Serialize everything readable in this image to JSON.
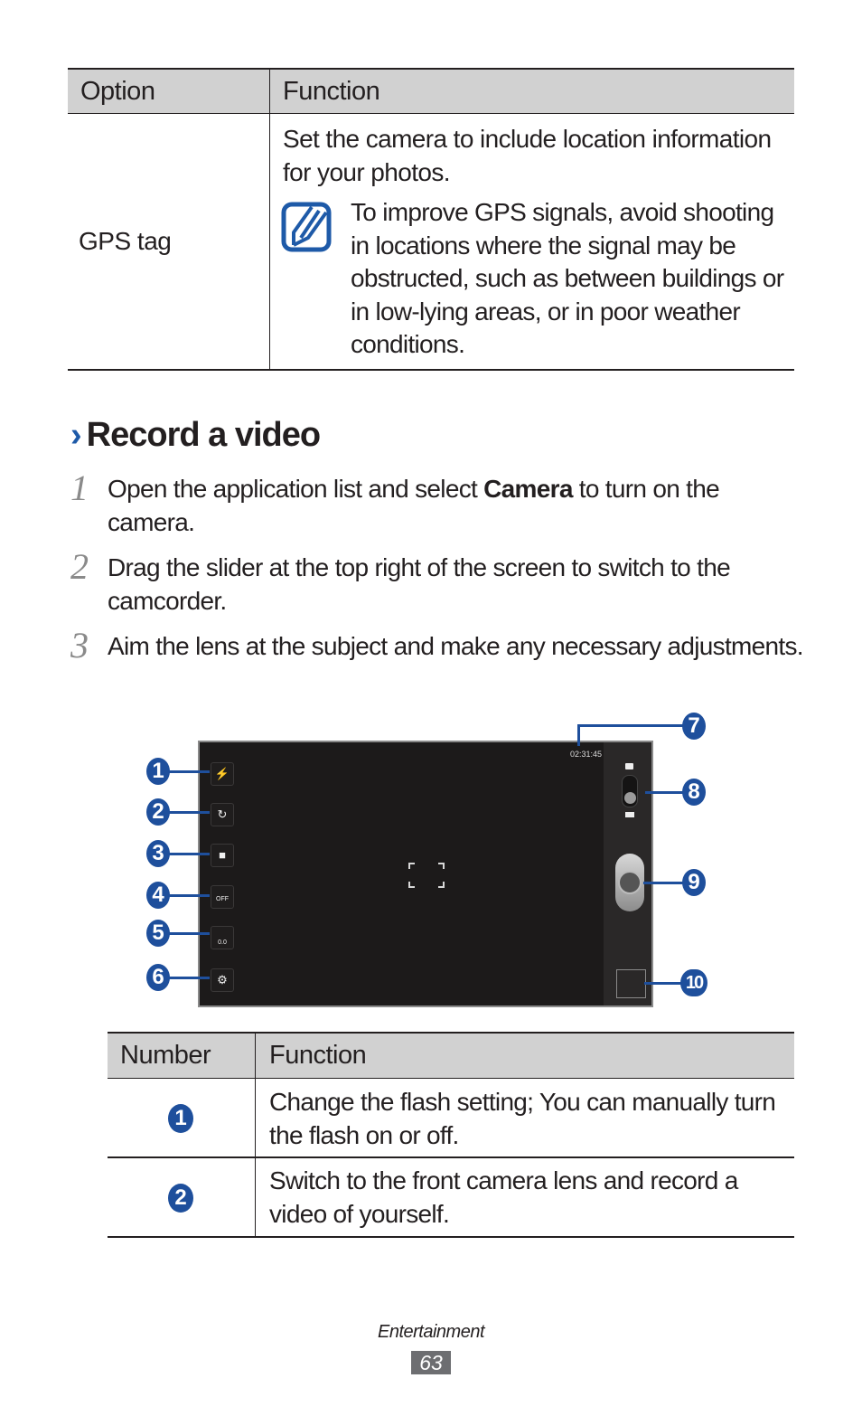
{
  "options_table": {
    "headers": [
      "Option",
      "Function"
    ],
    "rows": [
      {
        "option": "GPS tag",
        "function": "Set the camera to include location information for your photos.",
        "note_icon": "note-pencil-icon",
        "note": "To improve GPS signals, avoid shooting in locations where the signal may be obstructed, such as between buildings or in low-lying areas, or in poor weather conditions."
      }
    ]
  },
  "section": {
    "chevron": "›",
    "title": "Record a video"
  },
  "steps": [
    {
      "num": "1",
      "pre": "Open the application list and select ",
      "bold": "Camera",
      "post": " to turn on the camera."
    },
    {
      "num": "2",
      "text": "Drag the slider at the top right of the screen to switch to the camcorder."
    },
    {
      "num": "3",
      "text": "Aim the lens at the subject and make any necessary adjustments."
    }
  ],
  "camera_screen": {
    "recording_time": "02:31:45",
    "exposure_value": "0.0",
    "timer_label": "OFF",
    "left_buttons": [
      {
        "icon": "flash-off-icon",
        "callout": "1"
      },
      {
        "icon": "switch-camera-icon",
        "callout": "2"
      },
      {
        "icon": "recording-mode-icon",
        "callout": "3"
      },
      {
        "icon": "timer-off-icon",
        "callout": "4"
      },
      {
        "icon": "exposure-icon",
        "callout": "5"
      },
      {
        "icon": "settings-gear-icon",
        "callout": "6"
      }
    ],
    "right_callouts": [
      "7",
      "8",
      "9",
      "10"
    ],
    "mode_switch": {
      "top_icon": "camera-icon",
      "bottom_icon": "camcorder-icon",
      "selected": "camcorder"
    }
  },
  "number_table": {
    "headers": [
      "Number",
      "Function"
    ],
    "rows": [
      {
        "number": "1",
        "function": "Change the flash setting; You can manually turn the flash on or off."
      },
      {
        "number": "2",
        "function": "Switch to the front camera lens and record a video of yourself."
      }
    ]
  },
  "footer": {
    "section": "Entertainment",
    "page": "63"
  },
  "colors": {
    "accent_blue": "#1e4f9c",
    "header_gray": "#d1d1d1",
    "page_badge": "#6d6e71"
  }
}
